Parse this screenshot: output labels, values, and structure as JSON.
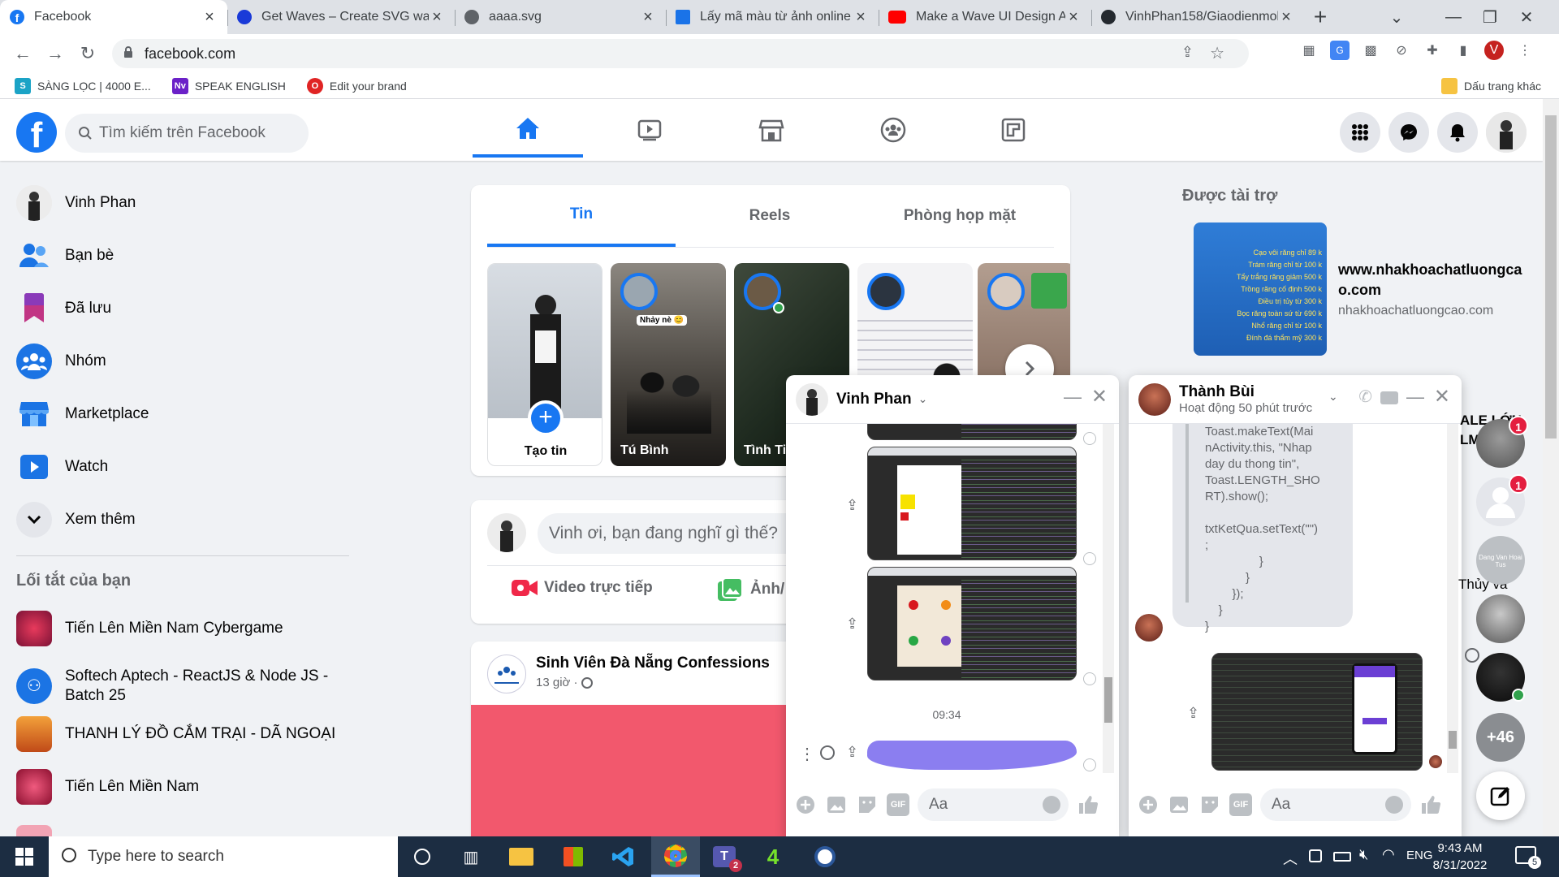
{
  "browser": {
    "tabs": [
      {
        "title": "Facebook",
        "color": "#1877f2"
      },
      {
        "title": "Get Waves – Create SVG wa",
        "color": "#1a73e8"
      },
      {
        "title": "aaaa.svg",
        "color": "#5f6368"
      },
      {
        "title": "Lấy mã màu từ ảnh online |",
        "color": "#1a73e8"
      },
      {
        "title": "Make a Wave UI Design An",
        "color": "#ff0000"
      },
      {
        "title": "VinhPhan158/Giaodienmob",
        "color": "#24292f"
      }
    ],
    "url": "facebook.com",
    "profile_initial": "V",
    "bookmarks": [
      {
        "label": "SÀNG LỌC | 4000 E...",
        "icon": "S"
      },
      {
        "label": "SPEAK ENGLISH",
        "icon": "Nv"
      },
      {
        "label": "Edit your brand",
        "icon": "O"
      }
    ],
    "other_bookmarks": "Dấu trang khác"
  },
  "fb": {
    "search_placeholder": "Tìm kiếm trên Facebook",
    "logo": "f"
  },
  "sidebar": {
    "user": "Vinh Phan",
    "items": [
      {
        "label": "Bạn bè",
        "icon": "friends-icon"
      },
      {
        "label": "Đã lưu",
        "icon": "saved-icon"
      },
      {
        "label": "Nhóm",
        "icon": "groups-icon"
      },
      {
        "label": "Marketplace",
        "icon": "marketplace-icon"
      },
      {
        "label": "Watch",
        "icon": "watch-icon"
      },
      {
        "label": "Xem thêm",
        "icon": "chevron-down-icon"
      }
    ],
    "shortcuts_title": "Lối tắt của bạn",
    "shortcuts": [
      "Tiến Lên Miền Nam Cybergame",
      "Softech Aptech - ReactJS & Node JS - Batch 25",
      "THANH LÝ ĐỒ CẮM TRẠI - DÃ NGOẠI",
      "Tiến Lên Miền Nam"
    ]
  },
  "stories": {
    "tabs": [
      "Tin",
      "Reels",
      "Phòng họp mặt"
    ],
    "create_label": "Tạo tin",
    "items": [
      {
        "name": "Tú Bình",
        "caption": "Nhảy nè 😊"
      },
      {
        "name": "Tình Ti"
      },
      {
        "name": ""
      },
      {
        "name": ""
      }
    ]
  },
  "composer": {
    "placeholder": "Vinh ơi, bạn đang nghĩ gì thế?",
    "live": "Video trực tiếp",
    "photo": "Ảnh/"
  },
  "post": {
    "page": "Sinh Viên Đà Nẵng Confessions",
    "time": "13 giờ ·"
  },
  "ads": {
    "title": "Được tài trợ",
    "site_title": "www.nhakhoachatluongcao.com",
    "site_url": "nhakhoachatluongcao.com",
    "banner_lines": [
      "Cạo vôi răng chỉ 89 k",
      "Trám răng chỉ từ 100 k",
      "Tẩy trắng răng giảm 500 k",
      "Trồng răng cố định 500 k",
      "Điều trị tủy từ 300 k",
      "Bọc răng toàn sứ từ 690 k",
      "Nhổ răng chỉ từ 100 k",
      "Đính đá thẩm mỹ 300 k"
    ]
  },
  "chat1": {
    "name": "Vinh Phan",
    "time": "09:34",
    "input_placeholder": "Aa"
  },
  "chat2": {
    "name": "Thành Bùi",
    "status": "Hoạt động 50 phút trước",
    "code_lines": [
      "Toast.makeText(Mai",
      "nActivity.this, \"Nhap",
      "day du thong tin\",",
      "Toast.LENGTH_SHO",
      "RT).show();",
      "",
      "txtKetQua.setText(\"\")",
      ";",
      "                }",
      "            }",
      "        });",
      "    }",
      "}"
    ],
    "input_placeholder": "Aa"
  },
  "rail": {
    "peek1": "ALE LỚN",
    "peek2": "LM",
    "peek3": "Thủy và",
    "badges": [
      "1",
      "1"
    ],
    "more_label": "+46",
    "contact_caption": "Dang Van Hoai Tus"
  },
  "taskbar": {
    "search_placeholder": "Type here to search",
    "lang": "ENG",
    "time": "9:43 AM",
    "date": "8/31/2022",
    "notif_count": "5",
    "teams_badge": "2"
  }
}
